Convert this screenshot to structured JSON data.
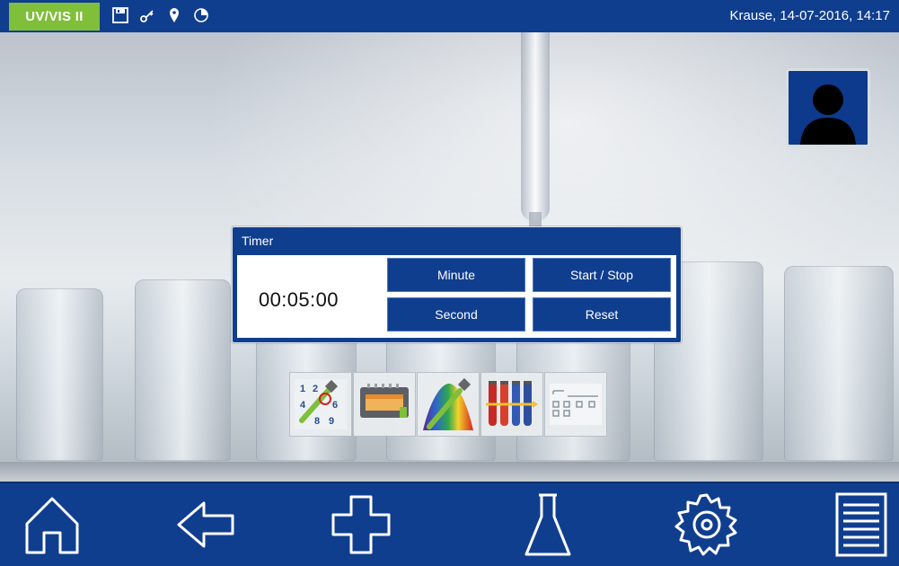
{
  "app": {
    "device_label": "UV/VIS II",
    "user_datetime": "Krause, 14-07-2016, 14:17"
  },
  "status_icons": [
    "save-icon",
    "key-icon",
    "location-pin-icon",
    "pie-chart-icon"
  ],
  "timer_dialog": {
    "title": "Timer",
    "value": "00:05:00",
    "buttons": {
      "minute": "Minute",
      "start_stop": "Start / Stop",
      "second": "Second",
      "reset": "Reset"
    }
  },
  "app_icons": [
    {
      "name": "method-numbers-icon",
      "digits": [
        "1",
        "2",
        "4",
        "6",
        "8",
        "9"
      ]
    },
    {
      "name": "device-tray-icon"
    },
    {
      "name": "spectrum-icon"
    },
    {
      "name": "test-tubes-icon"
    },
    {
      "name": "settings-list-icon"
    }
  ],
  "bottom_nav": [
    "home-icon",
    "back-arrow-icon",
    "plus-icon",
    "flask-icon",
    "gear-icon",
    "menu-list-icon"
  ],
  "colors": {
    "primary": "#103e8f",
    "accent": "#7fbf3a",
    "text_light": "#ffffff"
  }
}
